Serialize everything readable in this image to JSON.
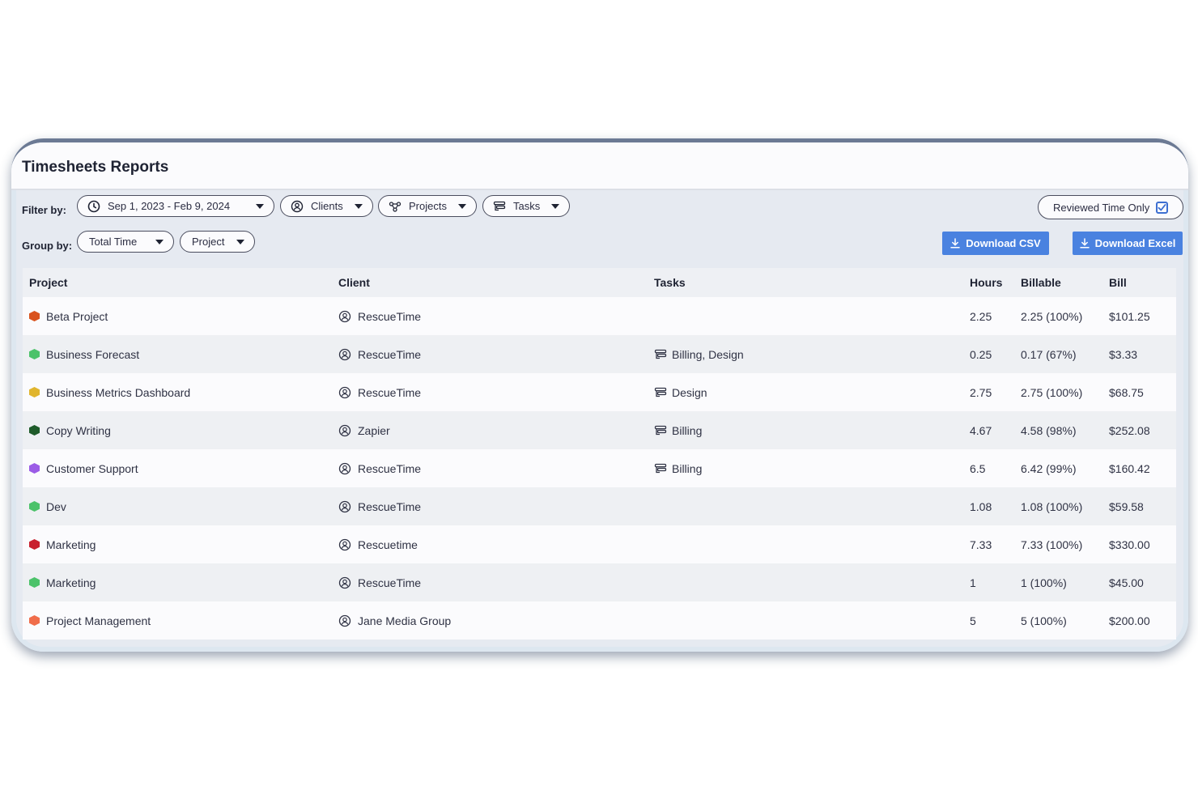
{
  "title": "Timesheets Reports",
  "filters": {
    "label": "Filter by:",
    "date_range": "Sep 1, 2023 - Feb 9, 2024",
    "clients": "Clients",
    "projects": "Projects",
    "tasks": "Tasks",
    "reviewed_label": "Reviewed Time Only",
    "reviewed_checked": true
  },
  "group": {
    "label": "Group by:",
    "primary": "Total Time",
    "secondary": "Project"
  },
  "actions": {
    "csv": "Download CSV",
    "excel": "Download Excel"
  },
  "colors": {
    "accent": "#4a82e0",
    "checkbox": "#3d6fd1"
  },
  "table": {
    "headers": {
      "project": "Project",
      "client": "Client",
      "tasks": "Tasks",
      "hours": "Hours",
      "billable": "Billable",
      "bill": "Bill"
    },
    "rows": [
      {
        "color": "#d9531e",
        "project": "Beta Project",
        "client": "RescueTime",
        "tasks": "",
        "hours": "2.25",
        "billable": "2.25 (100%)",
        "bill": "$101.25"
      },
      {
        "color": "#4cc26a",
        "project": "Business Forecast",
        "client": "RescueTime",
        "tasks": "Billing, Design",
        "hours": "0.25",
        "billable": "0.17 (67%)",
        "bill": "$3.33"
      },
      {
        "color": "#e0b52e",
        "project": "Business Metrics Dashboard",
        "client": "RescueTime",
        "tasks": "Design",
        "hours": "2.75",
        "billable": "2.75 (100%)",
        "bill": "$68.75"
      },
      {
        "color": "#1e5b2a",
        "project": "Copy Writing",
        "client": "Zapier",
        "tasks": "Billing",
        "hours": "4.67",
        "billable": "4.58 (98%)",
        "bill": "$252.08"
      },
      {
        "color": "#9b5ce6",
        "project": "Customer Support",
        "client": "RescueTime",
        "tasks": "Billing",
        "hours": "6.5",
        "billable": "6.42 (99%)",
        "bill": "$160.42"
      },
      {
        "color": "#4cc26a",
        "project": "Dev",
        "client": "RescueTime",
        "tasks": "",
        "hours": "1.08",
        "billable": "1.08 (100%)",
        "bill": "$59.58"
      },
      {
        "color": "#c8202e",
        "project": "Marketing",
        "client": "Rescuetime",
        "tasks": "",
        "hours": "7.33",
        "billable": "7.33 (100%)",
        "bill": "$330.00"
      },
      {
        "color": "#4cc26a",
        "project": "Marketing",
        "client": "RescueTime",
        "tasks": "",
        "hours": "1",
        "billable": "1 (100%)",
        "bill": "$45.00"
      },
      {
        "color": "#f06d4b",
        "project": "Project Management",
        "client": "Jane Media Group",
        "tasks": "",
        "hours": "5",
        "billable": "5 (100%)",
        "bill": "$200.00"
      }
    ]
  }
}
